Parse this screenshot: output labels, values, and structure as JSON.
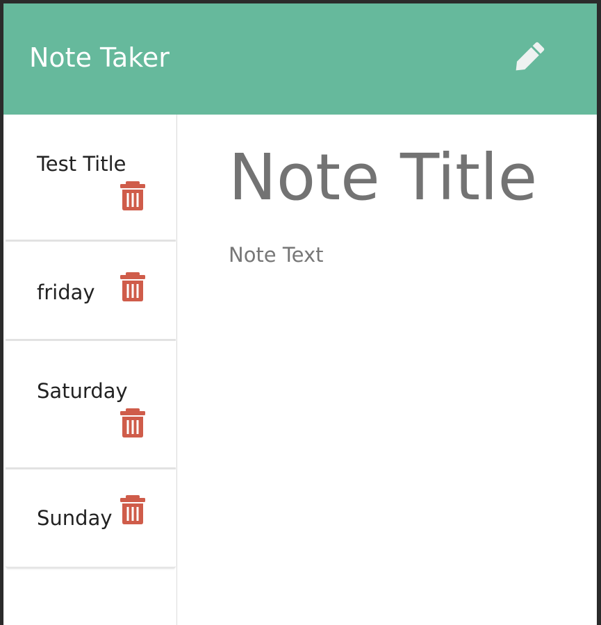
{
  "navbar": {
    "brand": "Note Taker",
    "new_note_icon": "pencil-icon"
  },
  "notes": [
    {
      "title": "Test Title",
      "delete_icon": "trash-icon"
    },
    {
      "title": "friday",
      "delete_icon": "trash-icon"
    },
    {
      "title": "Saturday",
      "delete_icon": "trash-icon"
    },
    {
      "title": "Sunday",
      "delete_icon": "trash-icon"
    }
  ],
  "editor": {
    "title_placeholder": "Note Title",
    "text_placeholder": "Note Text"
  },
  "colors": {
    "navbar_bg": "#66b99c",
    "delete_icon": "#cf5c4a",
    "pencil_icon": "#eef2f1",
    "placeholder_text": "#737373"
  }
}
